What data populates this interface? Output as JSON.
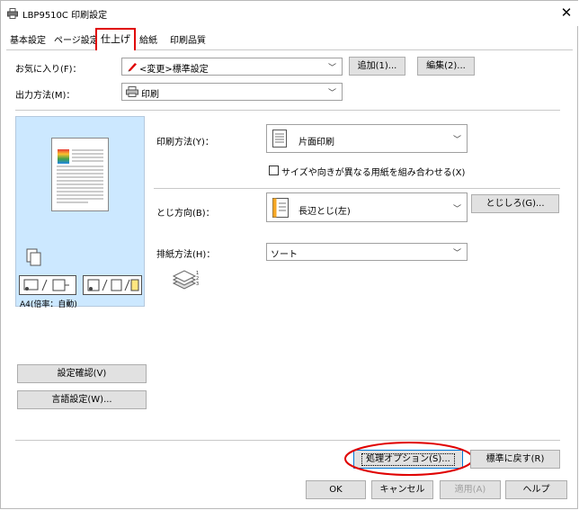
{
  "window": {
    "title": "LBP9510C 印刷設定",
    "close_glyph": "✕",
    "printer_icon": "printer-icon"
  },
  "tabs": [
    {
      "label": "基本設定"
    },
    {
      "label": "ページ設定"
    },
    {
      "label": "仕上げ"
    },
    {
      "label": "給紙"
    },
    {
      "label": "印刷品質"
    }
  ],
  "favorites": {
    "label": "お気に入り(F)：",
    "value": "<変更>標準設定",
    "add_button": "追加(1)...",
    "edit_button": "編集(2)..."
  },
  "output": {
    "label": "出力方法(M)：",
    "value": "印刷"
  },
  "preview": {
    "caption": "A4(倍率：自動)",
    "confirm_button": "設定確認(V)",
    "language_button": "言語設定(W)..."
  },
  "print_method": {
    "label": "印刷方法(Y)：",
    "value": "片面印刷",
    "checkbox_label": "サイズや向きが異なる用紙を組み合わせる(X)",
    "checkbox_checked": false
  },
  "binding": {
    "label": "とじ方向(B)：",
    "value": "長辺とじ(左)",
    "margin_button": "とじしろ(G)..."
  },
  "output_method": {
    "label": "排紙方法(H)：",
    "value": "ソート"
  },
  "bottom": {
    "processing_options": "処理オプション(S)...",
    "restore_defaults": "標準に戻す(R)"
  },
  "dialog": {
    "ok": "OK",
    "cancel": "キャンセル",
    "apply": "適用(A)",
    "help": "ヘルプ"
  },
  "colors": {
    "highlight_red": "#e00000",
    "preview_bg": "#cce8ff",
    "default_button_border": "#0078d7"
  }
}
